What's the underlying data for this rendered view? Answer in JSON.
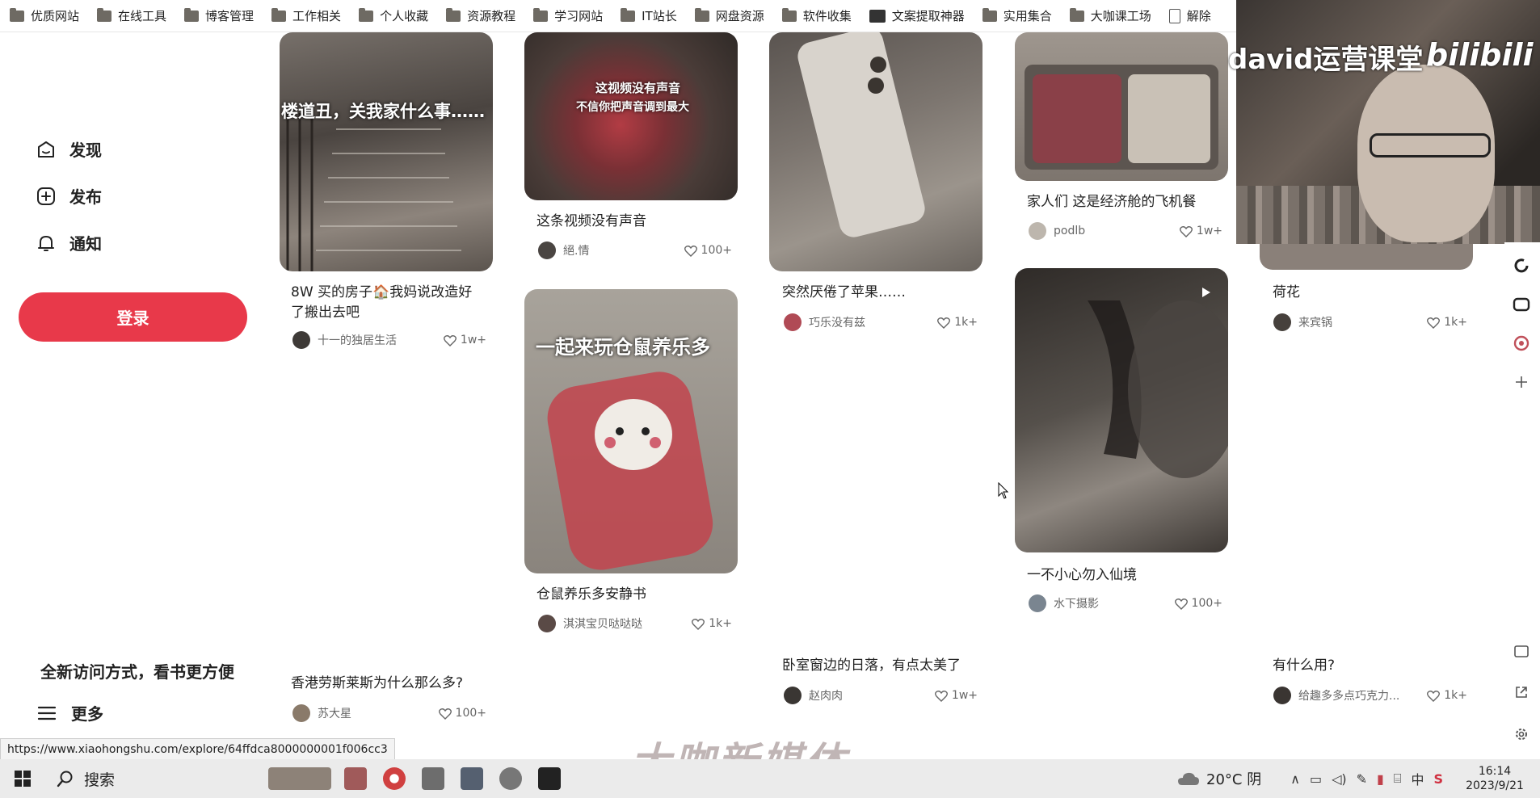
{
  "bookmarks": [
    {
      "label": "优质网站",
      "icon": "folder-icon"
    },
    {
      "label": "在线工具",
      "icon": "folder-icon"
    },
    {
      "label": "博客管理",
      "icon": "folder-icon"
    },
    {
      "label": "工作相关",
      "icon": "folder-icon"
    },
    {
      "label": "个人收藏",
      "icon": "folder-icon"
    },
    {
      "label": "资源教程",
      "icon": "folder-icon"
    },
    {
      "label": "学习网站",
      "icon": "folder-icon"
    },
    {
      "label": "IT站长",
      "icon": "folder-icon"
    },
    {
      "label": "网盘资源",
      "icon": "folder-icon"
    },
    {
      "label": "软件收集",
      "icon": "folder-icon"
    },
    {
      "label": "文案提取神器",
      "icon": "app-icon"
    },
    {
      "label": "实用集合",
      "icon": "folder-icon"
    },
    {
      "label": "大咖课工场",
      "icon": "folder-icon"
    },
    {
      "label": "解除",
      "icon": "doc-icon"
    }
  ],
  "sidebar": {
    "discover": "发现",
    "publish": "发布",
    "notify": "通知",
    "login": "登录",
    "promo": "全新访问方式，看书更方便",
    "more": "更多"
  },
  "feed": [
    {
      "title": "8W 买的房子🏠我妈说改造好了搬出去吧",
      "author": "十一的独居生活",
      "likes": "1w+",
      "overlay": "楼道丑，关我家什么事……"
    },
    {
      "title": "香港劳斯莱斯为什么那么多?",
      "author": "苏大星",
      "likes": "100+"
    },
    {
      "title": "这条视频没有声音",
      "author": "絕.情",
      "likes": "100+",
      "overlay_line1": "这视频没有声音",
      "overlay_line2": "不信你把声音调到最大"
    },
    {
      "title": "仓鼠养乐多安静书",
      "author": "淇淇宝贝哒哒哒",
      "likes": "1k+",
      "overlay": "一起来玩仓鼠养乐多"
    },
    {
      "title": "突然厌倦了苹果……",
      "author": "巧乐没有兹",
      "likes": "1k+"
    },
    {
      "title": "卧室窗边的日落，有点太美了",
      "author": "赵肉肉",
      "likes": "1w+"
    },
    {
      "title": "家人们 这是经济舱的飞机餐",
      "author": "podlb",
      "likes": "1w+"
    },
    {
      "title": "一不小心勿入仙境",
      "author": "水下摄影",
      "likes": "100+"
    },
    {
      "title": "荷花",
      "author": "来宾锅",
      "likes": "1k+"
    },
    {
      "title": "有什么用?",
      "author": "给趣多多点巧克力...",
      "likes": "1k+"
    }
  ],
  "webcam": {
    "title": "david运营课堂",
    "logo": "bilibili"
  },
  "status_url": "https://www.xiaohongshu.com/explore/64ffdca8000000001f006cc3",
  "watermark": "大咖新媒体",
  "taskbar": {
    "search": "搜索",
    "weather": "20°C 阴",
    "ime": "中",
    "time": "16:14",
    "date": "2023/9/21"
  }
}
